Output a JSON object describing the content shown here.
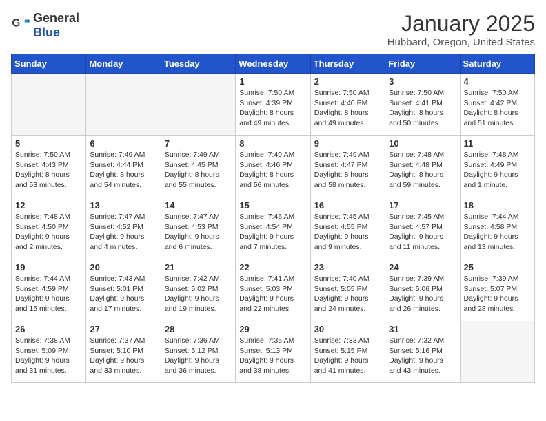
{
  "header": {
    "logo_general": "General",
    "logo_blue": "Blue",
    "title": "January 2025",
    "subtitle": "Hubbard, Oregon, United States"
  },
  "weekdays": [
    "Sunday",
    "Monday",
    "Tuesday",
    "Wednesday",
    "Thursday",
    "Friday",
    "Saturday"
  ],
  "weeks": [
    [
      {
        "day": "",
        "info": ""
      },
      {
        "day": "",
        "info": ""
      },
      {
        "day": "",
        "info": ""
      },
      {
        "day": "1",
        "info": "Sunrise: 7:50 AM\nSunset: 4:39 PM\nDaylight: 8 hours and 49 minutes."
      },
      {
        "day": "2",
        "info": "Sunrise: 7:50 AM\nSunset: 4:40 PM\nDaylight: 8 hours and 49 minutes."
      },
      {
        "day": "3",
        "info": "Sunrise: 7:50 AM\nSunset: 4:41 PM\nDaylight: 8 hours and 50 minutes."
      },
      {
        "day": "4",
        "info": "Sunrise: 7:50 AM\nSunset: 4:42 PM\nDaylight: 8 hours and 51 minutes."
      }
    ],
    [
      {
        "day": "5",
        "info": "Sunrise: 7:50 AM\nSunset: 4:43 PM\nDaylight: 8 hours and 53 minutes."
      },
      {
        "day": "6",
        "info": "Sunrise: 7:49 AM\nSunset: 4:44 PM\nDaylight: 8 hours and 54 minutes."
      },
      {
        "day": "7",
        "info": "Sunrise: 7:49 AM\nSunset: 4:45 PM\nDaylight: 8 hours and 55 minutes."
      },
      {
        "day": "8",
        "info": "Sunrise: 7:49 AM\nSunset: 4:46 PM\nDaylight: 8 hours and 56 minutes."
      },
      {
        "day": "9",
        "info": "Sunrise: 7:49 AM\nSunset: 4:47 PM\nDaylight: 8 hours and 58 minutes."
      },
      {
        "day": "10",
        "info": "Sunrise: 7:48 AM\nSunset: 4:48 PM\nDaylight: 8 hours and 59 minutes."
      },
      {
        "day": "11",
        "info": "Sunrise: 7:48 AM\nSunset: 4:49 PM\nDaylight: 9 hours and 1 minute."
      }
    ],
    [
      {
        "day": "12",
        "info": "Sunrise: 7:48 AM\nSunset: 4:50 PM\nDaylight: 9 hours and 2 minutes."
      },
      {
        "day": "13",
        "info": "Sunrise: 7:47 AM\nSunset: 4:52 PM\nDaylight: 9 hours and 4 minutes."
      },
      {
        "day": "14",
        "info": "Sunrise: 7:47 AM\nSunset: 4:53 PM\nDaylight: 9 hours and 6 minutes."
      },
      {
        "day": "15",
        "info": "Sunrise: 7:46 AM\nSunset: 4:54 PM\nDaylight: 9 hours and 7 minutes."
      },
      {
        "day": "16",
        "info": "Sunrise: 7:45 AM\nSunset: 4:55 PM\nDaylight: 9 hours and 9 minutes."
      },
      {
        "day": "17",
        "info": "Sunrise: 7:45 AM\nSunset: 4:57 PM\nDaylight: 9 hours and 11 minutes."
      },
      {
        "day": "18",
        "info": "Sunrise: 7:44 AM\nSunset: 4:58 PM\nDaylight: 9 hours and 13 minutes."
      }
    ],
    [
      {
        "day": "19",
        "info": "Sunrise: 7:44 AM\nSunset: 4:59 PM\nDaylight: 9 hours and 15 minutes."
      },
      {
        "day": "20",
        "info": "Sunrise: 7:43 AM\nSunset: 5:01 PM\nDaylight: 9 hours and 17 minutes."
      },
      {
        "day": "21",
        "info": "Sunrise: 7:42 AM\nSunset: 5:02 PM\nDaylight: 9 hours and 19 minutes."
      },
      {
        "day": "22",
        "info": "Sunrise: 7:41 AM\nSunset: 5:03 PM\nDaylight: 9 hours and 22 minutes."
      },
      {
        "day": "23",
        "info": "Sunrise: 7:40 AM\nSunset: 5:05 PM\nDaylight: 9 hours and 24 minutes."
      },
      {
        "day": "24",
        "info": "Sunrise: 7:39 AM\nSunset: 5:06 PM\nDaylight: 9 hours and 26 minutes."
      },
      {
        "day": "25",
        "info": "Sunrise: 7:39 AM\nSunset: 5:07 PM\nDaylight: 9 hours and 28 minutes."
      }
    ],
    [
      {
        "day": "26",
        "info": "Sunrise: 7:38 AM\nSunset: 5:09 PM\nDaylight: 9 hours and 31 minutes."
      },
      {
        "day": "27",
        "info": "Sunrise: 7:37 AM\nSunset: 5:10 PM\nDaylight: 9 hours and 33 minutes."
      },
      {
        "day": "28",
        "info": "Sunrise: 7:36 AM\nSunset: 5:12 PM\nDaylight: 9 hours and 36 minutes."
      },
      {
        "day": "29",
        "info": "Sunrise: 7:35 AM\nSunset: 5:13 PM\nDaylight: 9 hours and 38 minutes."
      },
      {
        "day": "30",
        "info": "Sunrise: 7:33 AM\nSunset: 5:15 PM\nDaylight: 9 hours and 41 minutes."
      },
      {
        "day": "31",
        "info": "Sunrise: 7:32 AM\nSunset: 5:16 PM\nDaylight: 9 hours and 43 minutes."
      },
      {
        "day": "",
        "info": ""
      }
    ]
  ]
}
